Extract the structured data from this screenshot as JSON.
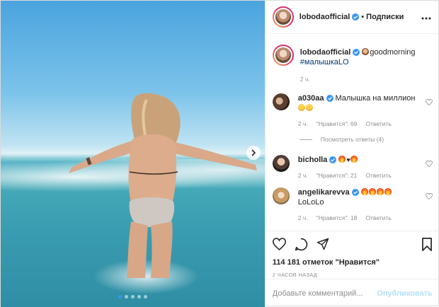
{
  "header": {
    "username": "lobodaofficial",
    "separator": "•",
    "follow_label": "Подписки",
    "more_label": "•••"
  },
  "caption": {
    "username": "lobodaofficial",
    "text_prefix": "goodmorning",
    "hashtag": "#малышкаLO",
    "time": "2 ч."
  },
  "comments": [
    {
      "username": "a030aa",
      "text": "Малышка на миллион",
      "time": "2 ч.",
      "likes": "\"Нравится\": 69",
      "reply": "Ответить"
    },
    {
      "username": "bicholla",
      "text": "",
      "time": "2 ч.",
      "likes": "\"Нравится\": 21",
      "reply": "Ответить"
    },
    {
      "username": "angelikarevva",
      "text": "LoLoLo",
      "time": "2 ч.",
      "likes": "\"Нравится\": 18",
      "reply": "Ответить"
    }
  ],
  "view_replies": "Посмотреть ответы (4)",
  "likes_count": "114 181 отметок \"Нравится\"",
  "post_time": "2 ЧАСОВ НАЗАД",
  "add_comment": {
    "placeholder": "Добавьте комментарий...",
    "publish_label": "Опубликовать"
  },
  "colors": {
    "link": "#00376b",
    "verified": "#3897f0",
    "publish_disabled": "#b2dffc",
    "muted": "#8e8e8e"
  },
  "carousel": {
    "slides": 5,
    "active": 1
  }
}
